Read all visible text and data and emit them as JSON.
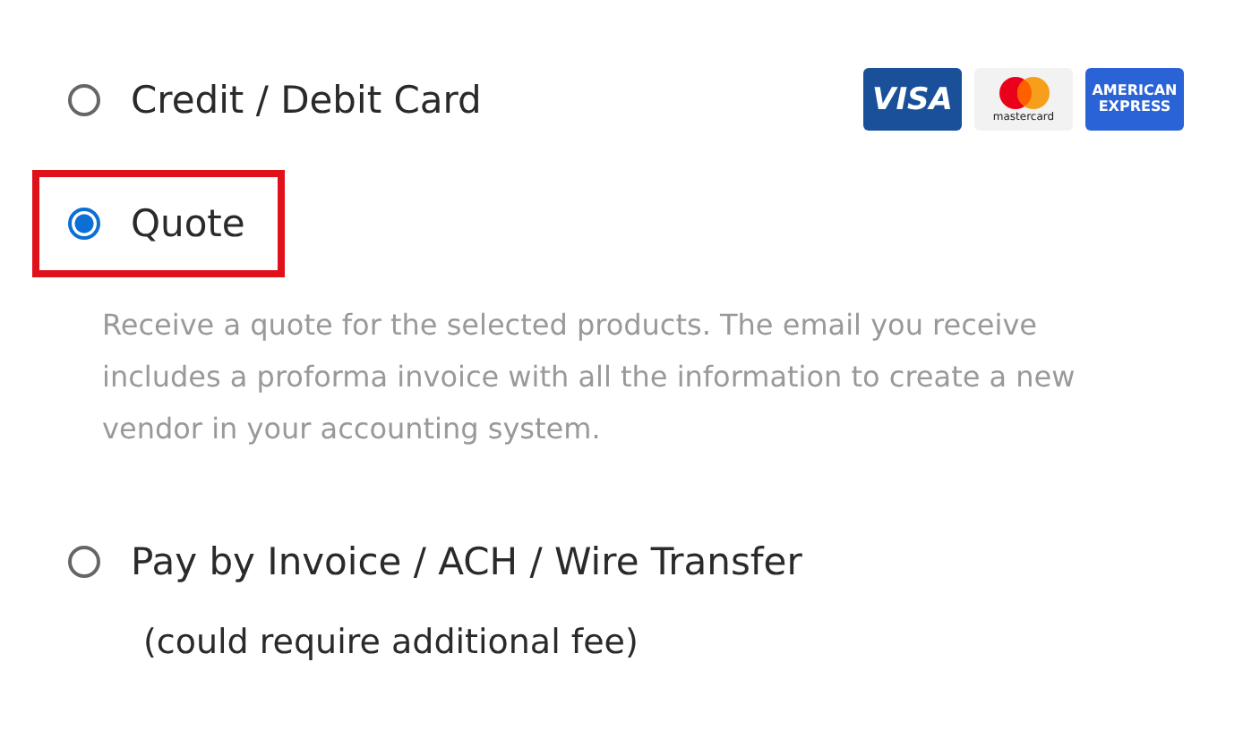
{
  "options": [
    {
      "label": "Credit / Debit Card",
      "selected": false,
      "highlighted": false,
      "cards": [
        {
          "kind": "visa",
          "text": "VISA"
        },
        {
          "kind": "mastercard",
          "text": "mastercard"
        },
        {
          "kind": "amex",
          "text": "AMERICAN EXPRESS"
        }
      ]
    },
    {
      "label": "Quote",
      "selected": true,
      "highlighted": true,
      "description": "Receive a quote for the selected products. The email you receive includes a proforma invoice with all the information to create a new vendor in your accounting system."
    },
    {
      "label": "Pay by Invoice / ACH / Wire Transfer",
      "selected": false,
      "highlighted": false,
      "note": "(could require additional fee)"
    }
  ]
}
